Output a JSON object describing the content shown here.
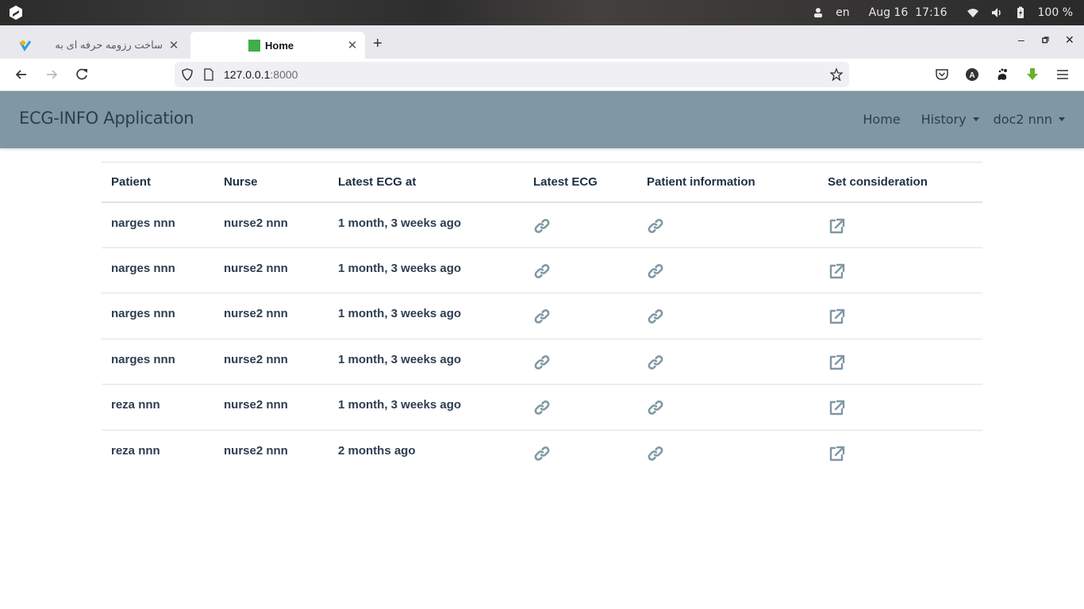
{
  "os": {
    "language": "en",
    "date": "Aug 16",
    "time": "17:16",
    "battery": "100 %"
  },
  "browser": {
    "tabs": [
      {
        "title": "ساخت رزومه حرفه ای به",
        "active": false
      },
      {
        "title": "Home",
        "active": true
      }
    ],
    "url_host": "127.0.0.1",
    "url_port": ":8000"
  },
  "app": {
    "brand": "ECG-INFO Application",
    "nav": {
      "home": "Home",
      "history": "History",
      "user": "doc2 nnn"
    },
    "accent": "#7f98a3"
  },
  "table": {
    "headers": [
      "Patient",
      "Nurse",
      "Latest ECG at",
      "Latest ECG",
      "Patient information",
      "Set consideration"
    ],
    "rows": [
      {
        "patient": "narges nnn",
        "nurse": "nurse2 nnn",
        "latest": "1 month, 3 weeks ago"
      },
      {
        "patient": "narges nnn",
        "nurse": "nurse2 nnn",
        "latest": "1 month, 3 weeks ago"
      },
      {
        "patient": "narges nnn",
        "nurse": "nurse2 nnn",
        "latest": "1 month, 3 weeks ago"
      },
      {
        "patient": "narges nnn",
        "nurse": "nurse2 nnn",
        "latest": "1 month, 3 weeks ago"
      },
      {
        "patient": "reza nnn",
        "nurse": "nurse2 nnn",
        "latest": "1 month, 3 weeks ago"
      },
      {
        "patient": "reza nnn",
        "nurse": "nurse2 nnn",
        "latest": "2 months ago"
      }
    ],
    "icons": {
      "latest_ecg": "link-icon",
      "patient_info": "link-icon",
      "set_consideration": "external-link-icon"
    }
  }
}
